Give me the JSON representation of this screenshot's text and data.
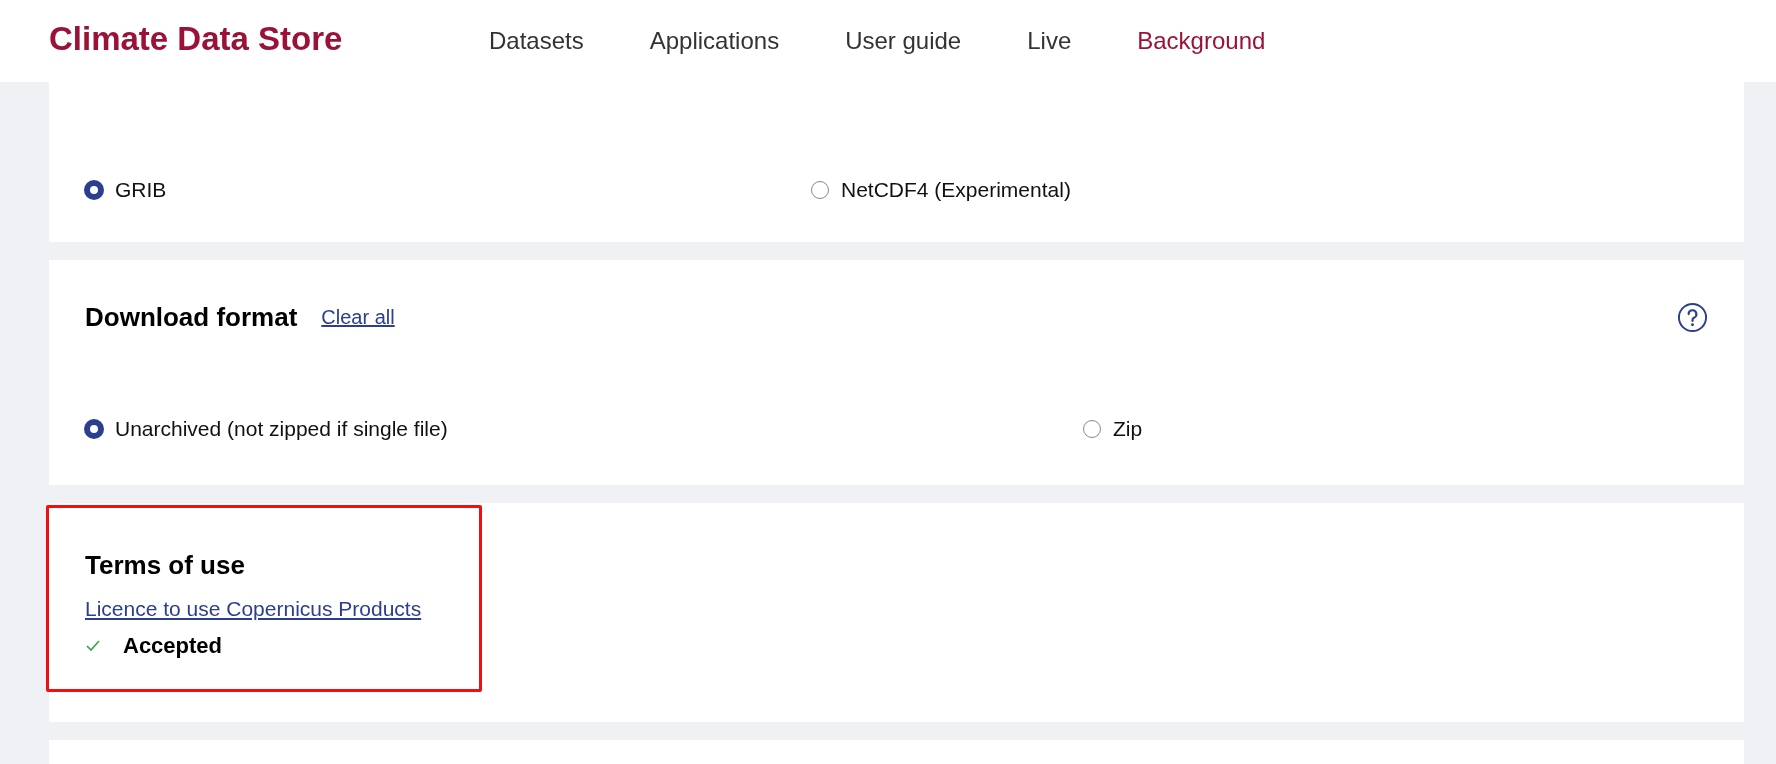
{
  "header": {
    "logo": "Climate Data Store",
    "nav": [
      {
        "label": "Datasets",
        "selected": false
      },
      {
        "label": "Applications",
        "selected": false
      },
      {
        "label": "User guide",
        "selected": false
      },
      {
        "label": "Live",
        "selected": false
      },
      {
        "label": "Background",
        "selected": true
      }
    ]
  },
  "sections": [
    {
      "kind": "options",
      "options": [
        {
          "label": "GRIB",
          "selected": true
        },
        {
          "label": "NetCDF4 (Experimental)",
          "selected": false
        }
      ]
    },
    {
      "kind": "options",
      "title": "Download format",
      "clear_link": "Clear all",
      "help": true,
      "options": [
        {
          "label": "Unarchived (not zipped if single file)",
          "selected": true
        },
        {
          "label": "Zip",
          "selected": false
        }
      ]
    },
    {
      "kind": "terms",
      "title": "Terms of use",
      "highlighted": true,
      "link": "Licence to use Copernicus Products",
      "status": {
        "label": "Accepted",
        "accepted": true
      }
    },
    {
      "kind": "empty"
    }
  ]
}
